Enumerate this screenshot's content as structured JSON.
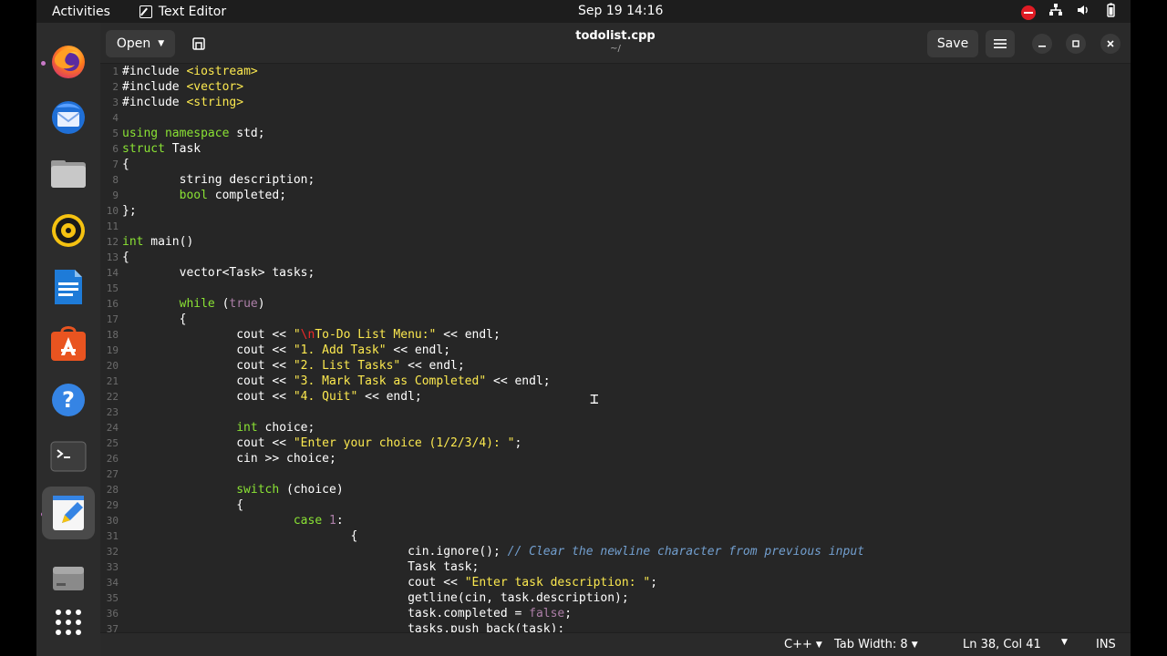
{
  "topbar": {
    "activities": "Activities",
    "app_name": "Text Editor",
    "clock": "Sep 19  14:16",
    "tray_icons": [
      "dnd-icon",
      "network-icon",
      "volume-icon",
      "battery-icon"
    ]
  },
  "dock": {
    "items": [
      "firefox",
      "thunderbird",
      "files",
      "rhythmbox",
      "libreoffice-writer",
      "app-center",
      "help",
      "terminal",
      "text-editor",
      "disk",
      "show-apps"
    ]
  },
  "header": {
    "open_label": "Open",
    "save_label": "Save",
    "title": "todolist.cpp",
    "subtitle": "~/"
  },
  "editor": {
    "lines": [
      "1",
      "2",
      "3",
      "4",
      "5",
      "6",
      "7",
      "8",
      "9",
      "10",
      "11",
      "12",
      "13",
      "14",
      "15",
      "16",
      "17",
      "18",
      "19",
      "20",
      "21",
      "22",
      "23",
      "24",
      "25",
      "26",
      "27",
      "28",
      "29",
      "30",
      "31",
      "32",
      "33",
      "34",
      "35",
      "36",
      "37"
    ]
  },
  "status": {
    "language": "C++",
    "tab_width": "Tab Width: 8",
    "position": "Ln 38, Col 41",
    "mode": "INS"
  },
  "colors": {
    "keyword": "#8ae234",
    "string": "#fce94f",
    "comment": "#729fcf",
    "editor_bg": "#262626"
  }
}
